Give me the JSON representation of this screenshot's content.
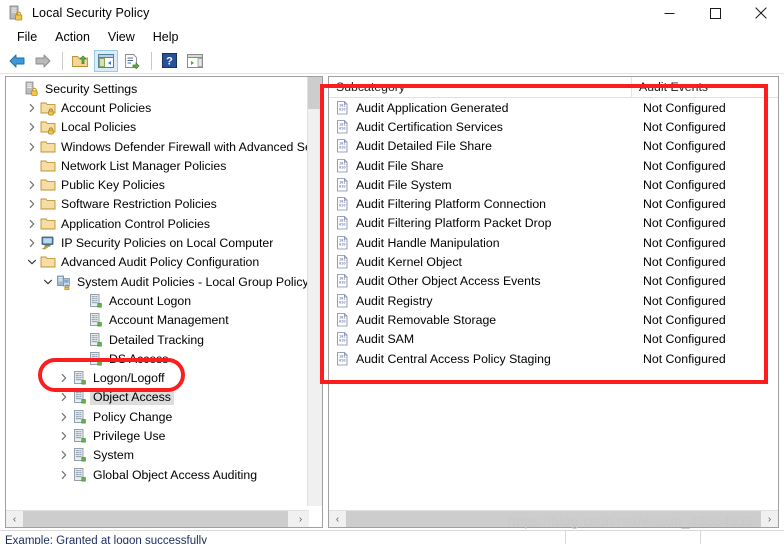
{
  "window": {
    "title": "Local Security Policy",
    "icon": "security-policy-icon",
    "controls": [
      {
        "name": "minimize-button",
        "glyph": "minimize"
      },
      {
        "name": "maximize-button",
        "glyph": "maximize"
      },
      {
        "name": "close-button",
        "glyph": "close"
      }
    ]
  },
  "menu": {
    "items": [
      {
        "label": "File"
      },
      {
        "label": "Action"
      },
      {
        "label": "View"
      },
      {
        "label": "Help"
      }
    ]
  },
  "toolbar": {
    "buttons": [
      {
        "name": "back-button",
        "icon": "back-arrow-icon",
        "selected": false
      },
      {
        "name": "forward-button",
        "icon": "forward-arrow-icon",
        "selected": false
      },
      {
        "name": "up-one-level-button",
        "icon": "folder-up-icon",
        "selected": false
      },
      {
        "name": "show-hide-console-tree-button",
        "icon": "console-tree-icon",
        "selected": true
      },
      {
        "name": "export-list-button",
        "icon": "export-list-icon",
        "selected": false
      },
      {
        "name": "help-button",
        "icon": "help-question-icon",
        "selected": false
      },
      {
        "name": "show-hide-action-pane-button",
        "icon": "action-pane-icon",
        "selected": false
      }
    ]
  },
  "tree": {
    "nodes": [
      {
        "label": "Security Settings",
        "indent": 0,
        "twist": "none",
        "icon": "security-settings-icon",
        "selected": false
      },
      {
        "label": "Account Policies",
        "indent": 1,
        "twist": "collapsed",
        "icon": "folder-lock-icon",
        "selected": false
      },
      {
        "label": "Local Policies",
        "indent": 1,
        "twist": "collapsed",
        "icon": "folder-lock-icon",
        "selected": false
      },
      {
        "label": "Windows Defender Firewall with Advanced Security",
        "indent": 1,
        "twist": "collapsed",
        "icon": "folder-icon",
        "selected": false
      },
      {
        "label": "Network List Manager Policies",
        "indent": 1,
        "twist": "none",
        "icon": "folder-icon",
        "selected": false
      },
      {
        "label": "Public Key Policies",
        "indent": 1,
        "twist": "collapsed",
        "icon": "folder-icon",
        "selected": false
      },
      {
        "label": "Software Restriction Policies",
        "indent": 1,
        "twist": "collapsed",
        "icon": "folder-icon",
        "selected": false
      },
      {
        "label": "Application Control Policies",
        "indent": 1,
        "twist": "collapsed",
        "icon": "folder-icon",
        "selected": false
      },
      {
        "label": "IP Security Policies on Local Computer",
        "indent": 1,
        "twist": "collapsed",
        "icon": "ip-security-icon",
        "selected": false
      },
      {
        "label": "Advanced Audit Policy Configuration",
        "indent": 1,
        "twist": "expanded",
        "icon": "folder-icon",
        "selected": false
      },
      {
        "label": "System Audit Policies - Local Group Policy Objec",
        "indent": 2,
        "twist": "expanded",
        "icon": "group-policy-icon",
        "selected": false
      },
      {
        "label": "Account Logon",
        "indent": 4,
        "twist": "none",
        "icon": "audit-category-icon",
        "selected": false
      },
      {
        "label": "Account Management",
        "indent": 4,
        "twist": "none",
        "icon": "audit-category-icon",
        "selected": false
      },
      {
        "label": "Detailed Tracking",
        "indent": 4,
        "twist": "none",
        "icon": "audit-category-icon",
        "selected": false
      },
      {
        "label": "DS Access",
        "indent": 4,
        "twist": "none",
        "icon": "audit-category-icon",
        "selected": false
      },
      {
        "label": "Logon/Logoff",
        "indent": 3,
        "twist": "collapsed",
        "icon": "audit-category-icon",
        "selected": false
      },
      {
        "label": "Object Access",
        "indent": 3,
        "twist": "collapsed",
        "icon": "audit-category-icon",
        "selected": true
      },
      {
        "label": "Policy Change",
        "indent": 3,
        "twist": "collapsed",
        "icon": "audit-category-icon",
        "selected": false
      },
      {
        "label": "Privilege Use",
        "indent": 3,
        "twist": "collapsed",
        "icon": "audit-category-icon",
        "selected": false
      },
      {
        "label": "System",
        "indent": 3,
        "twist": "collapsed",
        "icon": "audit-category-icon",
        "selected": false
      },
      {
        "label": "Global Object Access Auditing",
        "indent": 3,
        "twist": "collapsed",
        "icon": "audit-category-icon",
        "selected": false
      }
    ]
  },
  "list": {
    "columns": [
      {
        "label": "Subcategory",
        "name": "column-subcategory"
      },
      {
        "label": "Audit Events",
        "name": "column-audit-events"
      }
    ],
    "rows": [
      {
        "subcategory": "Audit Application Generated",
        "audit_events": "Not Configured"
      },
      {
        "subcategory": "Audit Certification Services",
        "audit_events": "Not Configured"
      },
      {
        "subcategory": "Audit Detailed File Share",
        "audit_events": "Not Configured"
      },
      {
        "subcategory": "Audit File Share",
        "audit_events": "Not Configured"
      },
      {
        "subcategory": "Audit File System",
        "audit_events": "Not Configured"
      },
      {
        "subcategory": "Audit Filtering Platform Connection",
        "audit_events": "Not Configured"
      },
      {
        "subcategory": "Audit Filtering Platform Packet Drop",
        "audit_events": "Not Configured"
      },
      {
        "subcategory": "Audit Handle Manipulation",
        "audit_events": "Not Configured"
      },
      {
        "subcategory": "Audit Kernel Object",
        "audit_events": "Not Configured"
      },
      {
        "subcategory": "Audit Other Object Access Events",
        "audit_events": "Not Configured"
      },
      {
        "subcategory": "Audit Registry",
        "audit_events": "Not Configured"
      },
      {
        "subcategory": "Audit Removable Storage",
        "audit_events": "Not Configured"
      },
      {
        "subcategory": "Audit SAM",
        "audit_events": "Not Configured"
      },
      {
        "subcategory": "Audit Central Access Policy Staging",
        "audit_events": "Not Configured"
      }
    ]
  },
  "scrollbars": {
    "left_h_left_arrow": "‹",
    "left_h_right_arrow": "›",
    "right_h_left_arrow": "‹",
    "right_h_right_arrow": "›"
  },
  "statusbar": {
    "text": "Example: Granted at logon successfully"
  },
  "annotations": {
    "rect_label": "audit-list-highlight",
    "oval_label": "object-access-highlight",
    "color": "#fc1d1d"
  },
  "watermark": {
    "text": "https://blog.csdn.net/weixin_43884933"
  }
}
